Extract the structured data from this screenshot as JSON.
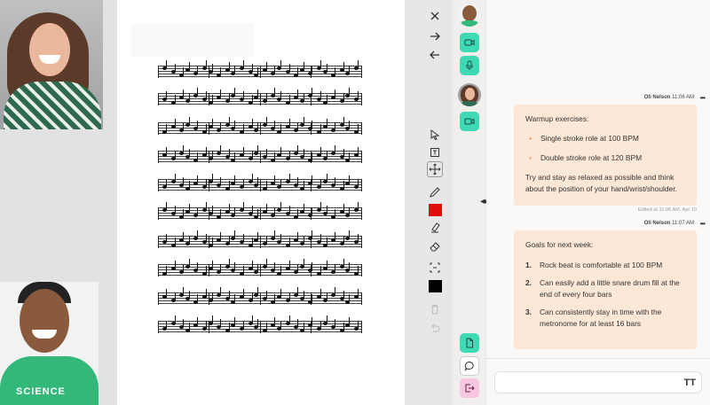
{
  "participants": [
    {
      "name": "participant-woman"
    },
    {
      "name": "participant-man",
      "shirt_text": "SCIENCE"
    }
  ],
  "tools": {
    "top": [
      "close-icon",
      "arrow-right-icon",
      "arrow-left-icon"
    ],
    "drawing": [
      "select-cursor-icon",
      "text-box-icon",
      "pan-icon",
      "pencil-icon",
      "color-red",
      "highlighter-icon",
      "eraser-icon",
      "crop-icon",
      "color-black",
      "trash-icon",
      "undo-icon"
    ],
    "colors": {
      "red": "#e01010",
      "black": "#000000"
    }
  },
  "rail": {
    "accent_green": "#3fd9b4",
    "accent_pink": "#f6c7e0"
  },
  "chat": {
    "messages": [
      {
        "author": "Oli Nelson",
        "time": "11:06 AM",
        "title": "Warmup exercises:",
        "bullets": [
          "Single stroke role at 100 BPM",
          "Double stroke role at 120 BPM"
        ],
        "body": "Try and stay as relaxed as possible and think about the position of your hand/wrist/shoulder.",
        "edited": "Edited at 11:06 AM, Apr 10"
      },
      {
        "author": "Oli Nelson",
        "time": "11:07 AM",
        "title": "Goals for next week:",
        "items": [
          {
            "num": "1.",
            "text": "Rock beat is comfortable at 100 BPM"
          },
          {
            "num": "2.",
            "text": "Can easily add a little snare drum fill at the end of every four bars"
          },
          {
            "num": "3.",
            "text": "Can consistently stay in time with the metronome for at least 16 bars"
          }
        ]
      }
    ],
    "more_label": "•••",
    "composer_placeholder": "",
    "format_label": "TT"
  },
  "colors": {
    "bubble": "#fde7d6",
    "bullet": "#e98a4c"
  }
}
